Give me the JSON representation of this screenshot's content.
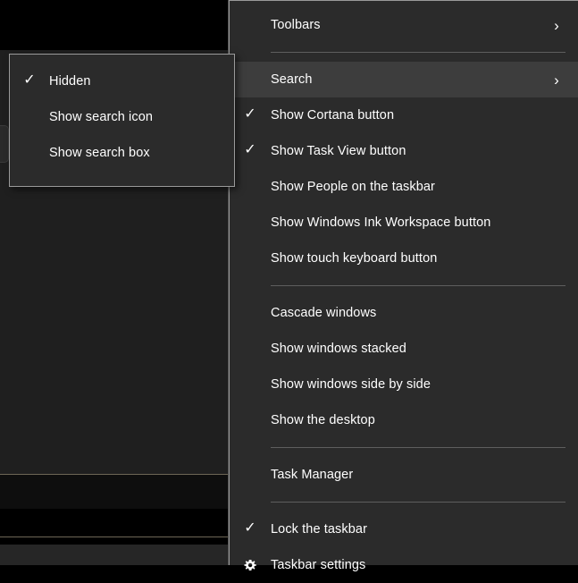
{
  "desktop": {
    "background_color": "#000000",
    "band_color": "#1f1f1f",
    "accent_line_color": "#6d6656"
  },
  "context_menu": {
    "name": "Taskbar context menu",
    "background_color": "#2b2b2b",
    "border_color": "#9a9a9a",
    "highlight_color": "#3d3d3d",
    "text_color": "#ffffff",
    "items": [
      {
        "label": "Toolbars",
        "checked": false,
        "submenu": true,
        "highlighted": false,
        "icon": ""
      },
      {
        "label": "Search",
        "checked": false,
        "submenu": true,
        "highlighted": true,
        "icon": ""
      },
      {
        "label": "Show Cortana button",
        "checked": true,
        "submenu": false,
        "highlighted": false,
        "icon": ""
      },
      {
        "label": "Show Task View button",
        "checked": true,
        "submenu": false,
        "highlighted": false,
        "icon": ""
      },
      {
        "label": "Show People on the taskbar",
        "checked": false,
        "submenu": false,
        "highlighted": false,
        "icon": ""
      },
      {
        "label": "Show Windows Ink Workspace button",
        "checked": false,
        "submenu": false,
        "highlighted": false,
        "icon": ""
      },
      {
        "label": "Show touch keyboard button",
        "checked": false,
        "submenu": false,
        "highlighted": false,
        "icon": ""
      },
      {
        "label": "Cascade windows",
        "checked": false,
        "submenu": false,
        "highlighted": false,
        "icon": ""
      },
      {
        "label": "Show windows stacked",
        "checked": false,
        "submenu": false,
        "highlighted": false,
        "icon": ""
      },
      {
        "label": "Show windows side by side",
        "checked": false,
        "submenu": false,
        "highlighted": false,
        "icon": ""
      },
      {
        "label": "Show the desktop",
        "checked": false,
        "submenu": false,
        "highlighted": false,
        "icon": ""
      },
      {
        "label": "Task Manager",
        "checked": false,
        "submenu": false,
        "highlighted": false,
        "icon": ""
      },
      {
        "label": "Lock the taskbar",
        "checked": true,
        "submenu": false,
        "highlighted": false,
        "icon": ""
      },
      {
        "label": "Taskbar settings",
        "checked": false,
        "submenu": false,
        "highlighted": false,
        "icon": "gear-icon"
      }
    ]
  },
  "search_submenu": {
    "name": "Search submenu",
    "background_color": "#2b2b2b",
    "border_color": "#9a9a9a",
    "items": [
      {
        "label": "Hidden",
        "checked": true
      },
      {
        "label": "Show search icon",
        "checked": false
      },
      {
        "label": "Show search box",
        "checked": false
      }
    ]
  },
  "glyphs": {
    "check": "✓",
    "chevron_right": "›"
  }
}
